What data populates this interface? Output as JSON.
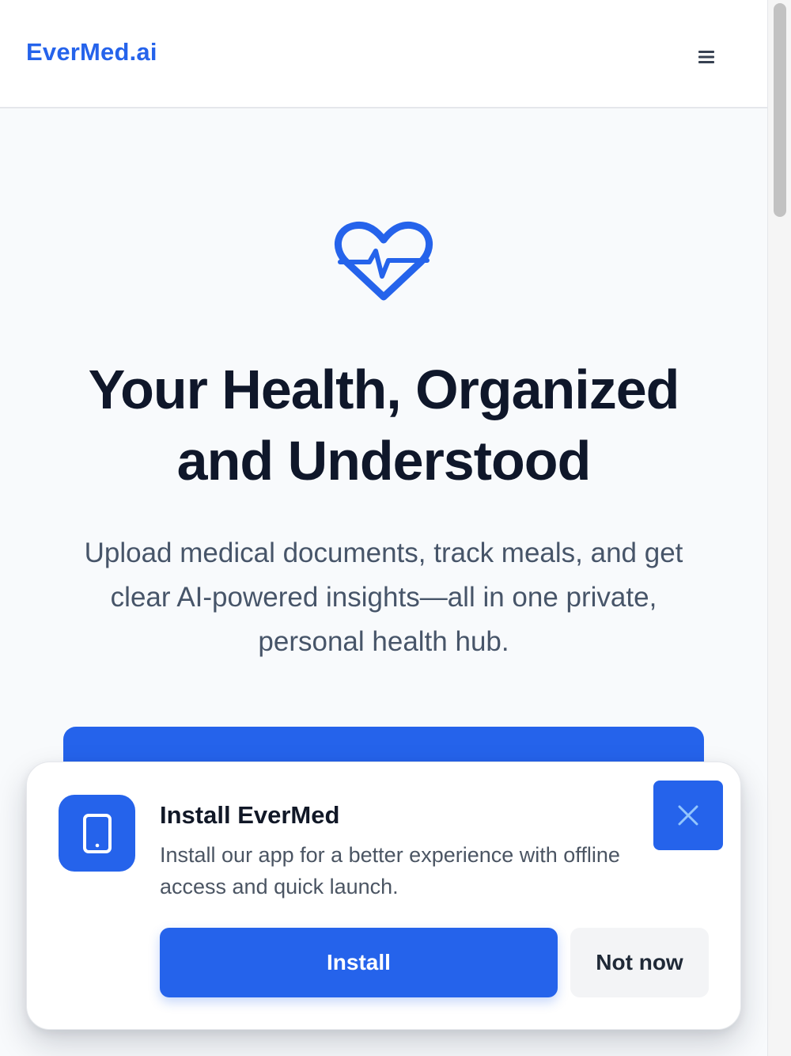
{
  "header": {
    "brand": "EverMed.ai",
    "menu_icon": "hamburger-menu-icon"
  },
  "hero": {
    "icon": "heart-pulse-icon",
    "title": "Your Health, Organized and Understood",
    "subtitle": "Upload medical documents, track meals, and get clear AI-powered insights—all in one private, personal health hub."
  },
  "install_prompt": {
    "app_icon": "smartphone-icon",
    "title": "Install EverMed",
    "description": "Install our app for a better experience with offline access and quick launch.",
    "install_label": "Install",
    "not_now_label": "Not now",
    "close_icon": "close-icon"
  },
  "colors": {
    "brand": "#2563eb",
    "heading": "#0f172a",
    "body_text": "#475569",
    "background": "#f8fafc"
  }
}
